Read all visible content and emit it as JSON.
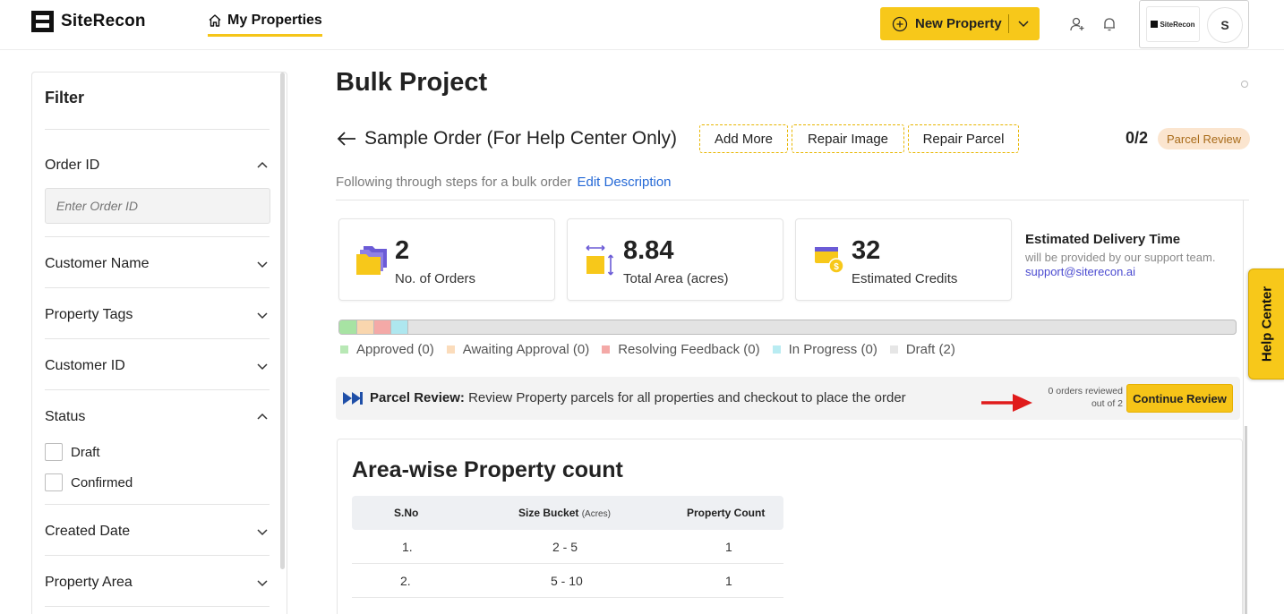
{
  "app": {
    "brand": "SiteRecon",
    "account_initial": "S",
    "account_brand": "SiteRecon"
  },
  "nav": {
    "tab_label": "My Properties",
    "new_property_label": "New Property"
  },
  "filter": {
    "title": "Filter",
    "order_id_label": "Order ID",
    "order_id_placeholder": "Enter Order ID",
    "customer_name": "Customer Name",
    "property_tags": "Property Tags",
    "customer_id": "Customer ID",
    "status": "Status",
    "status_options": [
      "Draft",
      "Confirmed"
    ],
    "created_date": "Created Date",
    "property_area": "Property Area"
  },
  "main": {
    "title": "Bulk Project",
    "order_name": "Sample Order (For Help Center Only)",
    "buttons": [
      "Add More",
      "Repair Image",
      "Repair Parcel"
    ],
    "count": "0/2",
    "badge": "Parcel Review",
    "description": "Following through steps for a bulk order",
    "edit_description": "Edit Description"
  },
  "stats": [
    {
      "value": "2",
      "label": "No. of Orders",
      "icon": "folders-icon"
    },
    {
      "value": "8.84",
      "label": "Total Area (acres)",
      "icon": "area-icon"
    },
    {
      "value": "32",
      "label": "Estimated Credits",
      "icon": "credits-icon"
    }
  ],
  "delivery": {
    "title": "Estimated Delivery Time",
    "text": "will be provided by our support team.",
    "email": "support@siterecon.ai"
  },
  "progress": {
    "segments": [
      {
        "color": "#a7e3a3"
      },
      {
        "color": "#f9d6ae"
      },
      {
        "color": "#f4a9a7"
      },
      {
        "color": "#aee7ef"
      }
    ]
  },
  "legend": [
    {
      "label": "Approved (0)",
      "color": "#b8e8b5"
    },
    {
      "label": "Awaiting Approval (0)",
      "color": "#fbdcbb"
    },
    {
      "label": "Resolving Feedback (0)",
      "color": "#f4a9a7"
    },
    {
      "label": "In Progress (0)",
      "color": "#b9ecf2"
    },
    {
      "label": "Draft (2)",
      "color": "#e6e6e6"
    }
  ],
  "review": {
    "label": "Parcel Review:",
    "text": "Review Property parcels for all properties and checkout to place the order",
    "count_line1": "0 orders reviewed",
    "count_line2": "out of 2",
    "button": "Continue Review"
  },
  "area_table": {
    "title": "Area-wise Property count",
    "headers": {
      "sno": "S.No",
      "size": "Size Bucket",
      "size_unit": "(Acres)",
      "count": "Property Count"
    },
    "rows": [
      {
        "sno": "1.",
        "size": "2 - 5",
        "count": "1"
      },
      {
        "sno": "2.",
        "size": "5 - 10",
        "count": "1"
      }
    ]
  },
  "help_center": "Help Center"
}
